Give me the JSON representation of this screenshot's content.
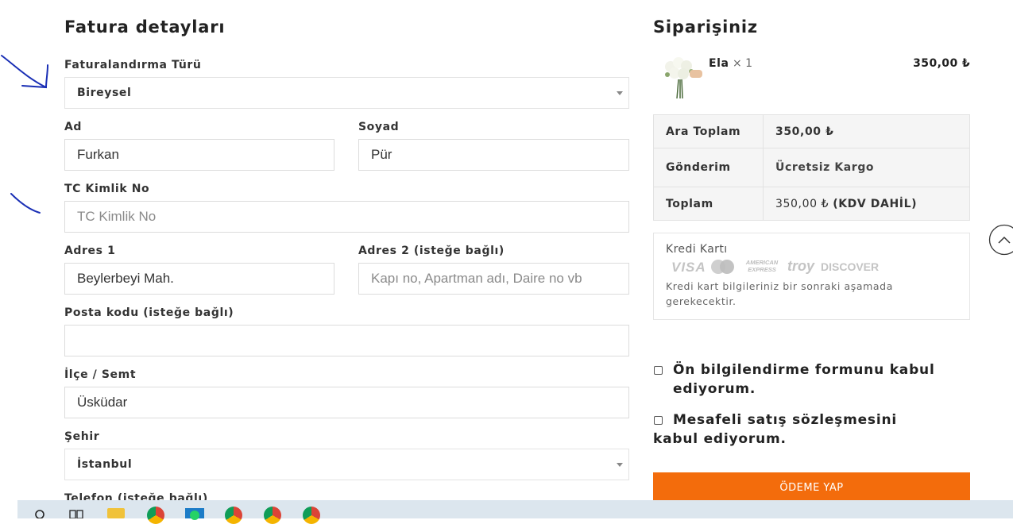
{
  "billing": {
    "title": "Fatura detayları",
    "invoice_type": {
      "label": "Faturalandırma Türü",
      "value": "Bireysel"
    },
    "first_name": {
      "label": "Ad",
      "value": "Furkan"
    },
    "last_name": {
      "label": "Soyad",
      "value": "Pür"
    },
    "tc_no": {
      "label": "TC Kimlik No",
      "placeholder": "TC Kimlik No"
    },
    "address1": {
      "label": "Adres 1",
      "value": "Beylerbeyi Mah."
    },
    "address2": {
      "label": "Adres 2 (isteğe bağlı)",
      "placeholder": "Kapı no, Apartman adı, Daire no vb"
    },
    "postcode": {
      "label": "Posta kodu (isteğe bağlı)",
      "value": ""
    },
    "district": {
      "label": "İlçe / Semt",
      "value": "Üsküdar"
    },
    "city": {
      "label": "Şehir",
      "value": "İstanbul"
    },
    "phone": {
      "label": "Telefon (isteğe bağlı)"
    }
  },
  "order": {
    "title": "Siparişiniz",
    "item": {
      "name": "Ela",
      "qty": "× 1",
      "price": "350,00 ₺"
    },
    "subtotal": {
      "label": "Ara Toplam",
      "value": "350,00 ₺"
    },
    "shipping": {
      "label": "Gönderim",
      "value": "Ücretsiz Kargo"
    },
    "total": {
      "label": "Toplam",
      "value": "350,00 ₺",
      "tax_note": "(KDV DAHİL)"
    }
  },
  "payment": {
    "method": "Kredi Kartı",
    "logos": {
      "visa": "VISA",
      "amex_top": "AMERICAN",
      "amex_bottom": "EXPRESS",
      "troy": "troy",
      "discover": "DISCOVER"
    },
    "note": "Kredi kart bilgileriniz bir sonraki aşamada gerekecektir."
  },
  "terms": {
    "preinfo": "Ön bilgilendirme formunu kabul ediyorum.",
    "distance_sales": "Mesafeli satış sözleşmesini kabul ediyorum."
  },
  "pay_button": "ÖDEME YAP",
  "colors": {
    "accent": "#f36c0c",
    "annotation": "#1a2fb5"
  }
}
